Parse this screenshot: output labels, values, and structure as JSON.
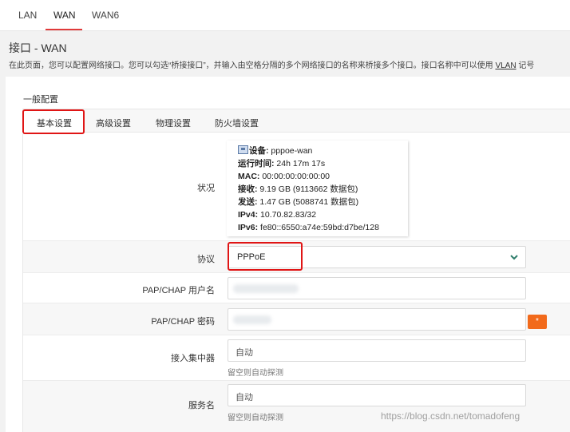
{
  "tabs": [
    {
      "label": "LAN"
    },
    {
      "label": "WAN"
    },
    {
      "label": "WAN6"
    }
  ],
  "page": {
    "title": "接口 - WAN",
    "description_prefix": "在此页面，您可以配置网络接口。您可以勾选“桥接接口”，并输入由空格分隔的多个网络接口的名称来桥接多个接口。接口名称中可以使用",
    "description_link": "VLAN",
    "description_suffix": "记号"
  },
  "section": {
    "label": "一般配置"
  },
  "subtabs": [
    {
      "label": "基本设置"
    },
    {
      "label": "高级设置"
    },
    {
      "label": "物理设置"
    },
    {
      "label": "防火墙设置"
    }
  ],
  "status": {
    "label": "状况",
    "device_label": "设备:",
    "device_value": "pppoe-wan",
    "uptime_label": "运行时间:",
    "uptime_value": "24h 17m 17s",
    "mac_label": "MAC:",
    "mac_value": "00:00:00:00:00:00",
    "rx_label": "接收:",
    "rx_value": "9.19 GB (9113662 数据包)",
    "tx_label": "发送:",
    "tx_value": "1.47 GB (5088741 数据包)",
    "ipv4_label": "IPv4:",
    "ipv4_value": "10.70.82.83/32",
    "ipv6_label": "IPv6:",
    "ipv6_value": "fe80::6550:a74e:59bd:d7be/128"
  },
  "protocol": {
    "label": "协议",
    "value": "PPPoE"
  },
  "username": {
    "label": "PAP/CHAP 用户名"
  },
  "password": {
    "label": "PAP/CHAP 密码",
    "reveal_icon": "*"
  },
  "ac": {
    "label": "接入集中器",
    "placeholder": "自动",
    "hint": "留空则自动探测"
  },
  "service": {
    "label": "服务名",
    "placeholder": "自动",
    "hint": "留空则自动探测"
  },
  "watermark": "https://blog.csdn.net/tomadofeng",
  "colors": {
    "accent": "#e03a3a",
    "highlight": "#e01515",
    "reveal_button": "#f26a1b",
    "chevron": "#2e7d6b"
  }
}
